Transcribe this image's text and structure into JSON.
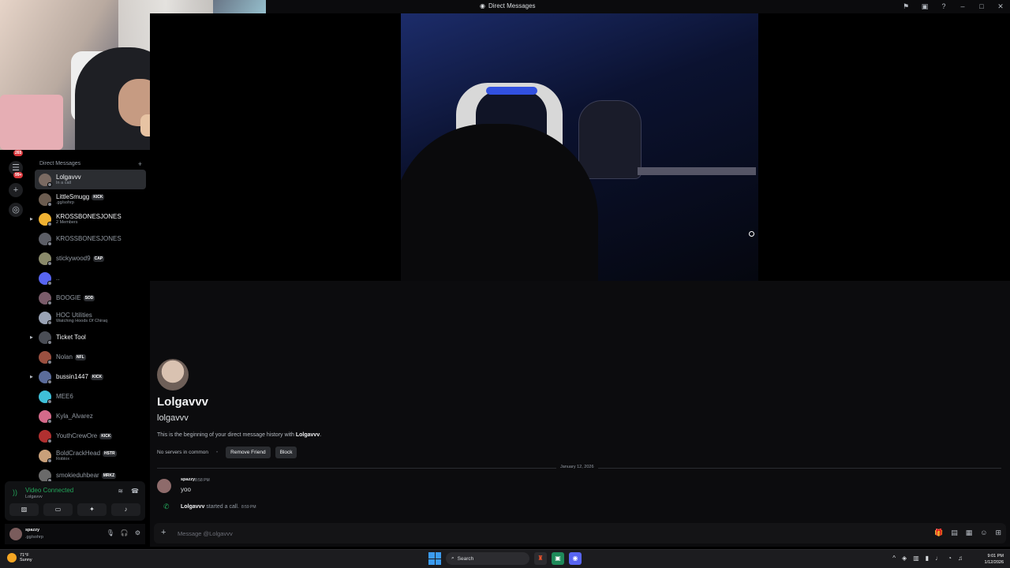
{
  "window": {
    "title": "Direct Messages"
  },
  "rail": {
    "badge_top": "265",
    "badge_second": "99+"
  },
  "dm_sidebar": {
    "header": "Direct Messages",
    "items": [
      {
        "name": "Lolgavvv",
        "sub": "In a call",
        "tag": "",
        "bright": true,
        "active": true,
        "color": "#7a6a62"
      },
      {
        "name": "LittleSmugg",
        "sub": ".gg/sohrp",
        "tag": "KICK",
        "bright": true,
        "color": "#6b5c50"
      },
      {
        "name": "KROSSBONESJONES",
        "sub": "2 Members",
        "tag": "",
        "bright": true,
        "color": "#f0b232"
      },
      {
        "name": "KROSSBONESJONES",
        "sub": "",
        "tag": "",
        "bright": false,
        "color": "#5c5e66"
      },
      {
        "name": "stickywood9",
        "sub": "",
        "tag": "CAP",
        "bright": false,
        "color": "#8a8a6a"
      },
      {
        "name": "..",
        "sub": "",
        "tag": "",
        "bright": false,
        "color": "#5865f2"
      },
      {
        "name": "BOOGIE",
        "sub": "",
        "tag": "SOD",
        "bright": false,
        "color": "#7a5c6a"
      },
      {
        "name": "HOC Utilities",
        "sub": "Watching Hoods Of Chiraq",
        "tag": "",
        "bright": false,
        "color": "#9aa3b5"
      },
      {
        "name": "Ticket Tool",
        "sub": "",
        "tag": "",
        "bright": true,
        "color": "#4a4d55"
      },
      {
        "name": "Nolan",
        "sub": "",
        "tag": "NFL",
        "bright": false,
        "color": "#9a5040"
      },
      {
        "name": "bussin1447",
        "sub": "",
        "tag": "KICK",
        "bright": true,
        "color": "#5b6c9a"
      },
      {
        "name": "MEE6",
        "sub": "",
        "tag": "",
        "bright": false,
        "color": "#3fbfd8"
      },
      {
        "name": "Kyla_Alvarez",
        "sub": "",
        "tag": "",
        "bright": false,
        "color": "#d46a8a"
      },
      {
        "name": "YouthCrewOre",
        "sub": "",
        "tag": "KICK",
        "bright": false,
        "color": "#b03030"
      },
      {
        "name": "BoldCrackHead",
        "sub": "Roblox ·",
        "tag": "HSTR",
        "bright": false,
        "color": "#c9a07a"
      },
      {
        "name": "smokieduhbear",
        "sub": "",
        "tag": "MRKZ",
        "bright": false,
        "color": "#6a6a6a"
      }
    ]
  },
  "voice_panel": {
    "title": "Video Connected",
    "sub": "Lolgavvv"
  },
  "user_panel": {
    "name": "spazzy",
    "status": ".gg/sohrp"
  },
  "profile": {
    "display_name": "Lolgavvv",
    "username": "lolgavvv",
    "intro_prefix": "This is the beginning of your direct message history with ",
    "intro_name": "Lolgavvv",
    "intro_suffix": ".",
    "servers": "No servers in common",
    "remove_friend": "Remove Friend",
    "block": "Block"
  },
  "messages": {
    "date": "January 12, 2026",
    "first": {
      "author": "spazzy",
      "time": "8:58 PM",
      "content": "yoo"
    },
    "call": {
      "author": "Lolgavvv",
      "text": " started a call.",
      "time": "8:59 PM"
    }
  },
  "composer": {
    "placeholder": "Message @Lolgavvv"
  },
  "taskbar": {
    "temp": "71°F",
    "weather": "Sunny",
    "search": "Search",
    "time": "9:01 PM",
    "date": "1/12/2026"
  }
}
